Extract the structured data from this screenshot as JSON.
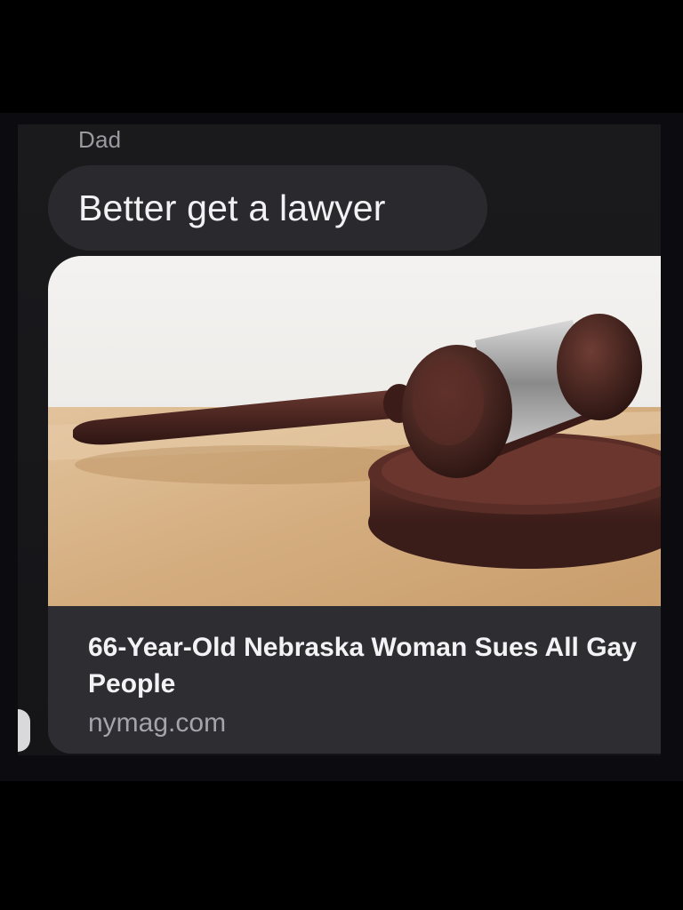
{
  "message": {
    "sender": "Dad",
    "text": "Better get a lawyer"
  },
  "link_preview": {
    "image_alt": "gavel",
    "headline": "66-Year-Old Nebraska Woman Sues All Gay People",
    "domain": "nymag.com"
  },
  "colors": {
    "background": "#000000",
    "bubble": "#2a2a2e",
    "card_footer": "#2e2e32",
    "text_primary": "#f2f2f4",
    "text_secondary": "#9a9aa0"
  }
}
